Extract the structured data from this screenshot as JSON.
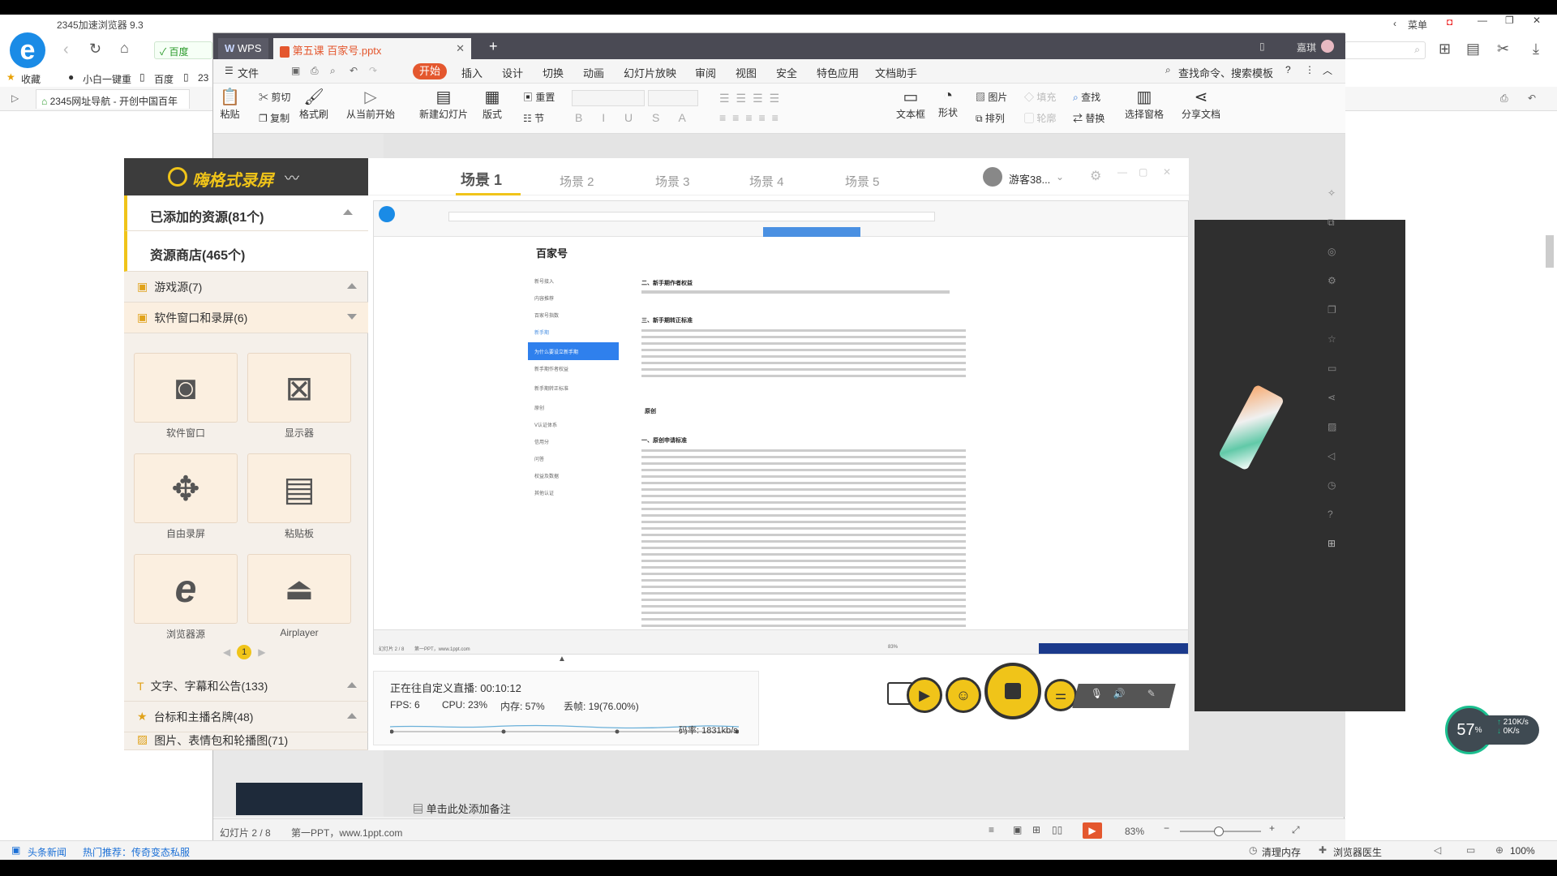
{
  "browser": {
    "title": "2345加速浏览器 9.3",
    "menu_label": "菜单",
    "addr_badge": "百度",
    "fav": [
      "收藏",
      "小白一键重",
      "百度",
      "23"
    ],
    "tab_label": "2345网址导航 - 开创中国百年",
    "status_news": "头条新闻",
    "status_hot": "热门推荐：传奇变态私服",
    "status_clean": "清理内存",
    "status_doctor": "浏览器医生",
    "status_zoom": "100%"
  },
  "wps": {
    "tab_wps": "WPS",
    "tab_doc": "第五课 百家号.pptx",
    "user": "嘉琪",
    "menu": [
      "文件",
      "开始",
      "插入",
      "设计",
      "切换",
      "动画",
      "幻灯片放映",
      "审阅",
      "视图",
      "安全",
      "特色应用",
      "文档助手"
    ],
    "search": "查找命令、搜索模板",
    "ribbon": {
      "paste": "粘贴",
      "cut": "剪切",
      "copy": "复制",
      "format": "格式刷",
      "from_current": "从当前开始",
      "new_slide": "新建幻灯片",
      "layout": "版式",
      "section": "节",
      "reset": "重置",
      "textbox": "文本框",
      "shape": "形状",
      "picture": "图片",
      "arrange": "排列",
      "find": "查找",
      "replace": "替换",
      "select_pane": "选择窗格",
      "share": "分享文档",
      "fill": "填充",
      "outline": "轮廓"
    },
    "slide_status": "幻灯片 2 / 8",
    "theme": "第一PPT，www.1ppt.com",
    "notes": "单击此处添加备注",
    "zoom": "83%"
  },
  "recorder": {
    "logo": "嗨格式录屏",
    "added": "已添加的资源(81个)",
    "store": "资源商店(465个)",
    "cat_game": "游戏源(7)",
    "cat_software": "软件窗口和录屏(6)",
    "tiles": [
      "软件窗口",
      "显示器",
      "自由录屏",
      "粘贴板",
      "浏览器源",
      "Airplayer"
    ],
    "page": "1",
    "cat_text": "文字、字幕和公告(133)",
    "cat_badge": "台标和主播名牌(48)",
    "cat_image": "图片、表情包和轮播图(71)",
    "scenes": [
      "场景 1",
      "场景 2",
      "场景 3",
      "场景 4",
      "场景 5"
    ],
    "user": "游客38...",
    "live_status": "正在往自定义直播: 00:10:12",
    "fps": "FPS:  6",
    "cpu": "CPU: 23%",
    "mem": "内存: 57%",
    "drop": "丢帧: 19(76.00%)",
    "bitrate": "码率: 1831kb/s"
  },
  "preview": {
    "brand": "百家号",
    "nav": [
      "新号接入",
      "内容推荐",
      "百家号指数",
      "新手期",
      "为什么要设立新手期",
      "新手期作者权益",
      "新手期转正标准",
      "原创",
      "V认证体系",
      "信用分",
      "问答",
      "权益及数据",
      "其他认证"
    ],
    "h1": "二、新手期作者权益",
    "h2": "三、新手期转正标准",
    "h3": "原创",
    "h4": "一、原创申请标准",
    "footer_left": "幻灯片 2 / 8",
    "footer_theme": "第一PPT，www.1ppt.com",
    "footer_zoom": "83%"
  },
  "net": {
    "percent": "57",
    "unit": "%",
    "up": "210K/s",
    "down": "0K/s"
  },
  "colors": {
    "accent": "#f0c419",
    "wps_tab": "#4a4a54",
    "wps_orange": "#e4572e",
    "rec_dark": "#3c3c3c"
  }
}
